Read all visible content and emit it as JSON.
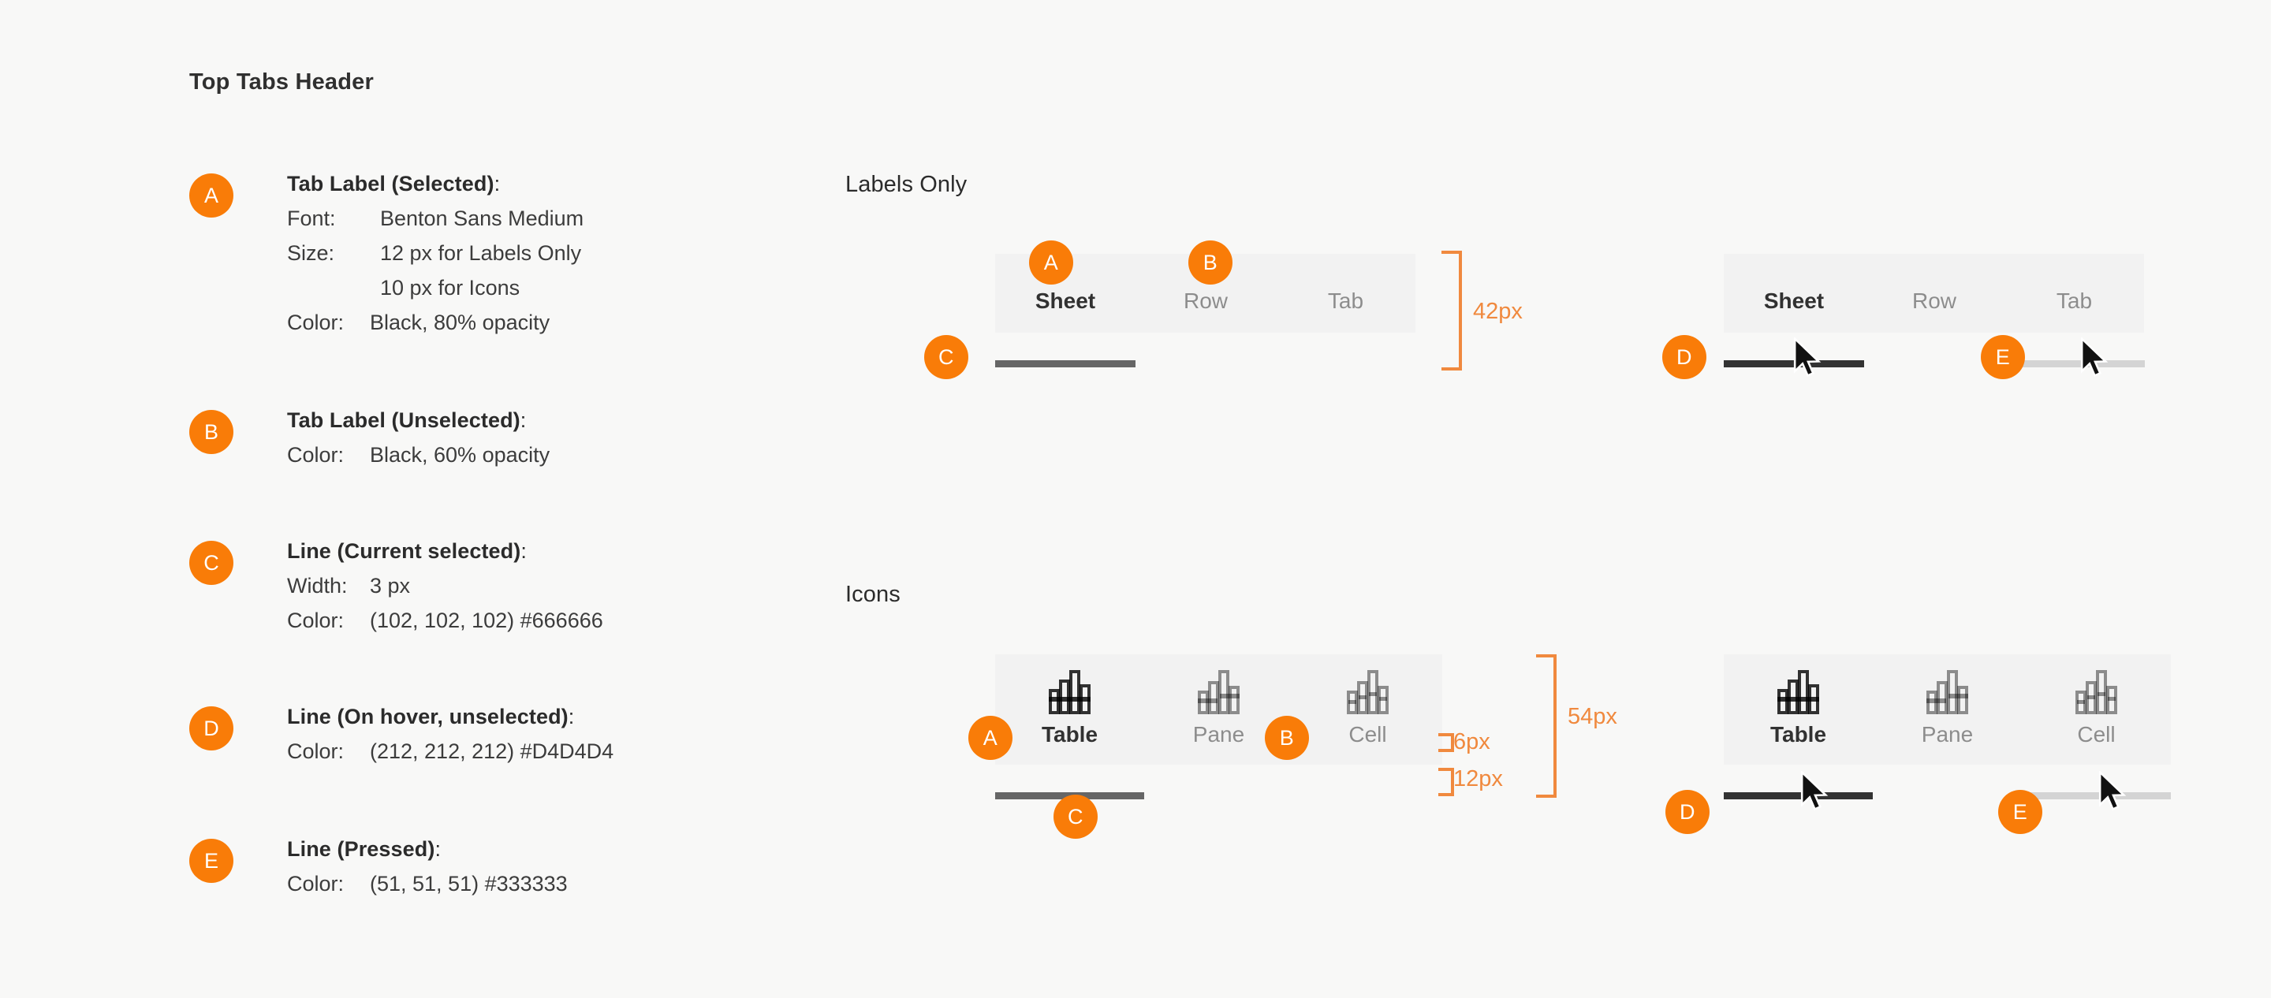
{
  "page": {
    "background": "#f8f8f7",
    "accent": "#f97c08",
    "annotation_color": "#f0893e"
  },
  "spec": {
    "title": "Top Tabs Header",
    "items": [
      {
        "marker": "A",
        "heading": "Tab Label (Selected)",
        "rows": [
          {
            "key": "Font:",
            "value": "Benton Sans Medium"
          },
          {
            "key": "Size:",
            "value": "12 px for Labels Only"
          },
          {
            "key": "",
            "value": "10 px for Icons"
          },
          {
            "key": "Color:",
            "value": "Black, 80% opacity"
          }
        ]
      },
      {
        "marker": "B",
        "heading": "Tab Label (Unselected)",
        "rows": [
          {
            "key": "Color:",
            "value": "Black, 60% opacity"
          }
        ]
      },
      {
        "marker": "C",
        "heading": "Line (Current selected)",
        "rows": [
          {
            "key": "Width:",
            "value": "3 px"
          },
          {
            "key": "Color:",
            "value": "(102, 102, 102) #666666"
          }
        ]
      },
      {
        "marker": "D",
        "heading": "Line (On hover, unselected)",
        "rows": [
          {
            "key": "Color:",
            "value": "(212, 212, 212) #D4D4D4"
          }
        ]
      },
      {
        "marker": "E",
        "heading": "Line (Pressed)",
        "rows": [
          {
            "key": "Color:",
            "value": "(51, 51, 51) #333333"
          }
        ]
      }
    ]
  },
  "sections": {
    "labels_only": {
      "title": "Labels Only",
      "height_annotation": "42px",
      "left_example": {
        "tabs": [
          {
            "label": "Sheet",
            "state": "selected"
          },
          {
            "label": "Row",
            "state": "unselected"
          },
          {
            "label": "Tab",
            "state": "unselected"
          }
        ],
        "markers": [
          "A",
          "B",
          "C"
        ]
      },
      "right_example": {
        "tabs": [
          {
            "label": "Sheet",
            "state": "pressed"
          },
          {
            "label": "Row",
            "state": "unselected"
          },
          {
            "label": "Tab",
            "state": "hover"
          }
        ],
        "markers": [
          "D",
          "E"
        ]
      }
    },
    "icons": {
      "title": "Icons",
      "height_annotation": "54px",
      "gap_annotations": [
        "6px",
        "12px"
      ],
      "left_example": {
        "tabs": [
          {
            "label": "Table",
            "icon": "bar-chart-table-icon",
            "state": "selected"
          },
          {
            "label": "Pane",
            "icon": "bar-chart-pane-icon",
            "state": "unselected"
          },
          {
            "label": "Cell",
            "icon": "bar-chart-cell-icon",
            "state": "unselected"
          }
        ],
        "markers": [
          "A",
          "B",
          "C"
        ]
      },
      "right_example": {
        "tabs": [
          {
            "label": "Table",
            "icon": "bar-chart-table-icon",
            "state": "pressed"
          },
          {
            "label": "Pane",
            "icon": "bar-chart-pane-icon",
            "state": "unselected"
          },
          {
            "label": "Cell",
            "icon": "bar-chart-cell-icon",
            "state": "hover"
          }
        ],
        "markers": [
          "D",
          "E"
        ]
      }
    }
  }
}
